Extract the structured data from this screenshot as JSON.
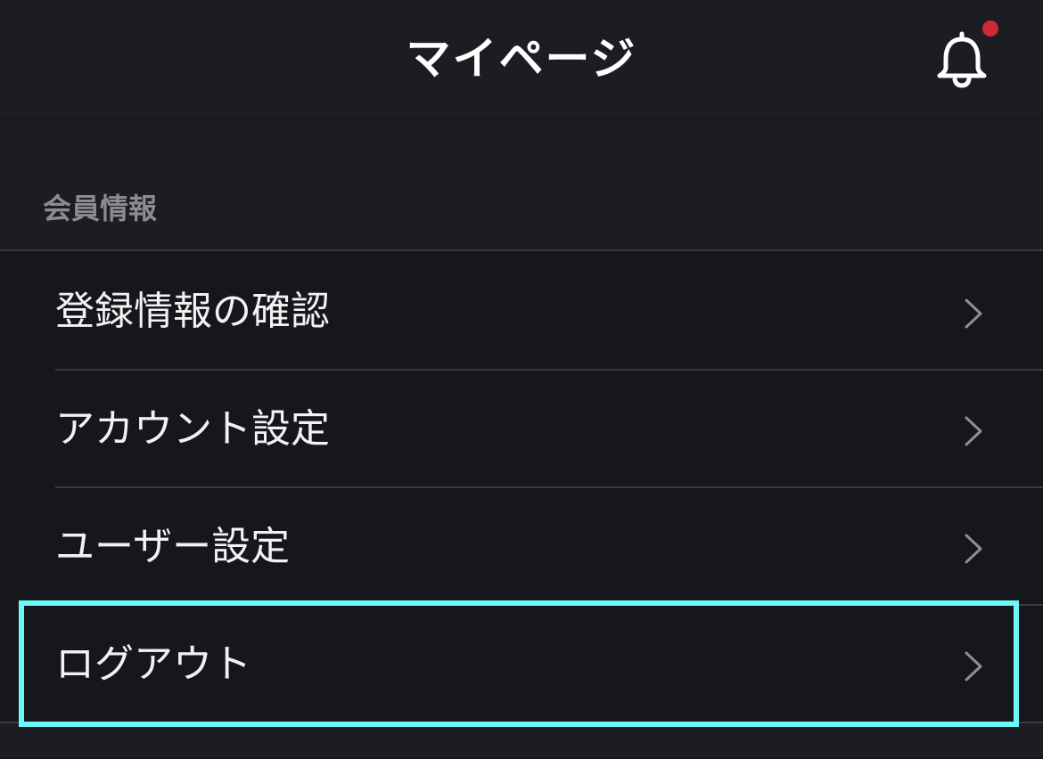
{
  "header": {
    "title": "マイページ",
    "notification_icon": "bell-icon",
    "notification_badge": true,
    "badge_color": "#cc2b33"
  },
  "section": {
    "title": "会員情報"
  },
  "menu": {
    "items": [
      {
        "label": "登録情報の確認",
        "icon": "chevron-right-icon"
      },
      {
        "label": "アカウント設定",
        "icon": "chevron-right-icon"
      },
      {
        "label": "ユーザー設定",
        "icon": "chevron-right-icon"
      },
      {
        "label": "ログアウト",
        "icon": "chevron-right-icon",
        "highlighted": true
      }
    ]
  },
  "colors": {
    "background": "#1c1d22",
    "list_background": "#16171c",
    "highlight": "#6ef7f8",
    "section_title": "#8b8b90"
  }
}
